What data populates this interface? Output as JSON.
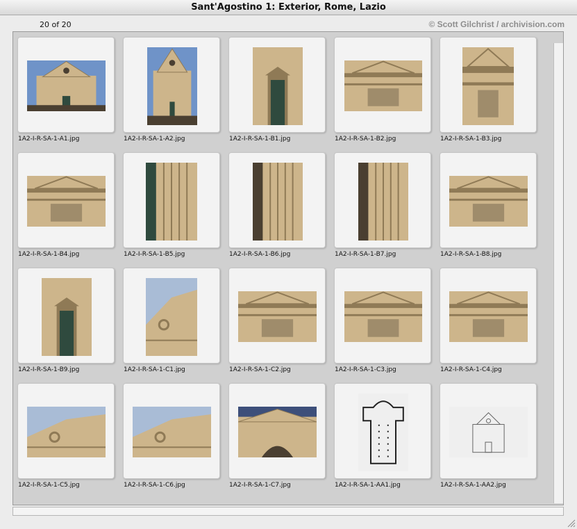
{
  "window": {
    "title": "Sant'Agostino 1: Exterior, Rome, Lazio"
  },
  "header": {
    "count": "20 of 20",
    "credit": "© Scott Gilchrist / archivision.com"
  },
  "items": [
    {
      "file": "1A2-I-R-SA-1-A1.jpg",
      "image": "church-facade-photo"
    },
    {
      "file": "1A2-I-R-SA-1-A2.jpg",
      "image": "church-facade-photo"
    },
    {
      "file": "1A2-I-R-SA-1-B1.jpg",
      "image": "portal-door-photo"
    },
    {
      "file": "1A2-I-R-SA-1-B2.jpg",
      "image": "pediment-inscription-photo"
    },
    {
      "file": "1A2-I-R-SA-1-B3.jpg",
      "image": "door-frame-detail-photo"
    },
    {
      "file": "1A2-I-R-SA-1-B4.jpg",
      "image": "cornice-bracket-photo"
    },
    {
      "file": "1A2-I-R-SA-1-B5.jpg",
      "image": "door-jamb-photo"
    },
    {
      "file": "1A2-I-R-SA-1-B6.jpg",
      "image": "carved-pilaster-photo"
    },
    {
      "file": "1A2-I-R-SA-1-B7.jpg",
      "image": "molding-detail-photo"
    },
    {
      "file": "1A2-I-R-SA-1-B8.jpg",
      "image": "inscription-frieze-photo"
    },
    {
      "file": "1A2-I-R-SA-1-B9.jpg",
      "image": "side-door-photo"
    },
    {
      "file": "1A2-I-R-SA-1-C1.jpg",
      "image": "volute-sky-photo"
    },
    {
      "file": "1A2-I-R-SA-1-C2.jpg",
      "image": "entablature-photo"
    },
    {
      "file": "1A2-I-R-SA-1-C3.jpg",
      "image": "pediment-detail-photo"
    },
    {
      "file": "1A2-I-R-SA-1-C4.jpg",
      "image": "cornice-shield-photo"
    },
    {
      "file": "1A2-I-R-SA-1-C5.jpg",
      "image": "pediment-sky-photo"
    },
    {
      "file": "1A2-I-R-SA-1-C6.jpg",
      "image": "volute-sky-photo"
    },
    {
      "file": "1A2-I-R-SA-1-C7.jpg",
      "image": "arched-window-photo"
    },
    {
      "file": "1A2-I-R-SA-1-AA1.jpg",
      "image": "floor-plan-drawing"
    },
    {
      "file": "1A2-I-R-SA-1-AA2.jpg",
      "image": "elevation-drawing"
    }
  ],
  "colors": {
    "stone": "#cdb58b",
    "stone_dark": "#8f7a56",
    "sky": "#6f93c8",
    "door": "#2f4a3e",
    "shadow": "#4a3f31"
  }
}
